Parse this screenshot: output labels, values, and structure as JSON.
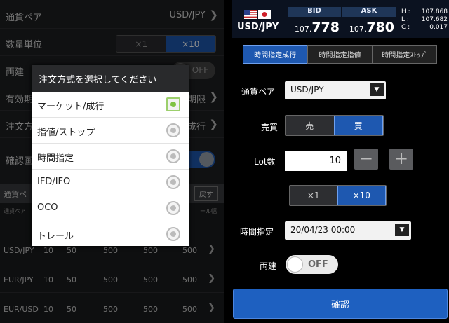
{
  "left": {
    "rows": [
      {
        "label": "通貨ペア",
        "value": "USD/JPY"
      },
      {
        "label": "数量単位",
        "seg": [
          "×1",
          "×10"
        ]
      },
      {
        "label": "両建",
        "toggle": "OFF"
      },
      {
        "label": "有効期",
        "value": "期限"
      },
      {
        "label": "注文方",
        "value": "成行"
      },
      {
        "label": "確認画"
      }
    ],
    "table_header": "通貨ペ",
    "table_button": "戻す",
    "sub_left": "通貨ペア",
    "sub_right": "ール幅",
    "table_rows": [
      {
        "pair": "USD/JPY",
        "c": [
          "10",
          "50",
          "500",
          "500",
          "500"
        ]
      },
      {
        "pair": "EUR/JPY",
        "c": [
          "10",
          "50",
          "500",
          "500",
          "500"
        ]
      },
      {
        "pair": "EUR/USD",
        "c": [
          "10",
          "50",
          "500",
          "500",
          "500"
        ]
      }
    ],
    "dialog": {
      "title": "注文方式を選択してください",
      "options": [
        "マーケット/成行",
        "指値/ストップ",
        "時間指定",
        "IFD/IFO",
        "OCO",
        "トレール"
      ],
      "selected_index": 0
    }
  },
  "right": {
    "pair": "USD/JPY",
    "bid": {
      "label": "BID",
      "small": "107.",
      "big": "778"
    },
    "ask": {
      "label": "ASK",
      "small": "107.",
      "big": "780"
    },
    "hlc": [
      {
        "k": "H :",
        "v": "107.868"
      },
      {
        "k": "L :",
        "v": "107.682"
      },
      {
        "k": "C :",
        "v": "0.017"
      }
    ],
    "tabs": [
      "時間指定成行",
      "時間指定指値",
      "時間指定ｽﾄｯﾌﾟ"
    ],
    "active_tab": 0,
    "pair_label": "通貨ペア",
    "pair_value": "USD/JPY",
    "side_label": "売買",
    "sell": "売",
    "buy": "買",
    "lot_label": "Lot数",
    "lot_value": "10",
    "minus": "−",
    "plus": "+",
    "mult": [
      "×1",
      "×10"
    ],
    "time_label": "時間指定",
    "time_value": "20/04/23 00:00",
    "hedge_label": "両建",
    "hedge_value": "OFF",
    "confirm": "確認",
    "colors": {
      "accent": "#1e58b0",
      "check": "#7ec242"
    }
  }
}
